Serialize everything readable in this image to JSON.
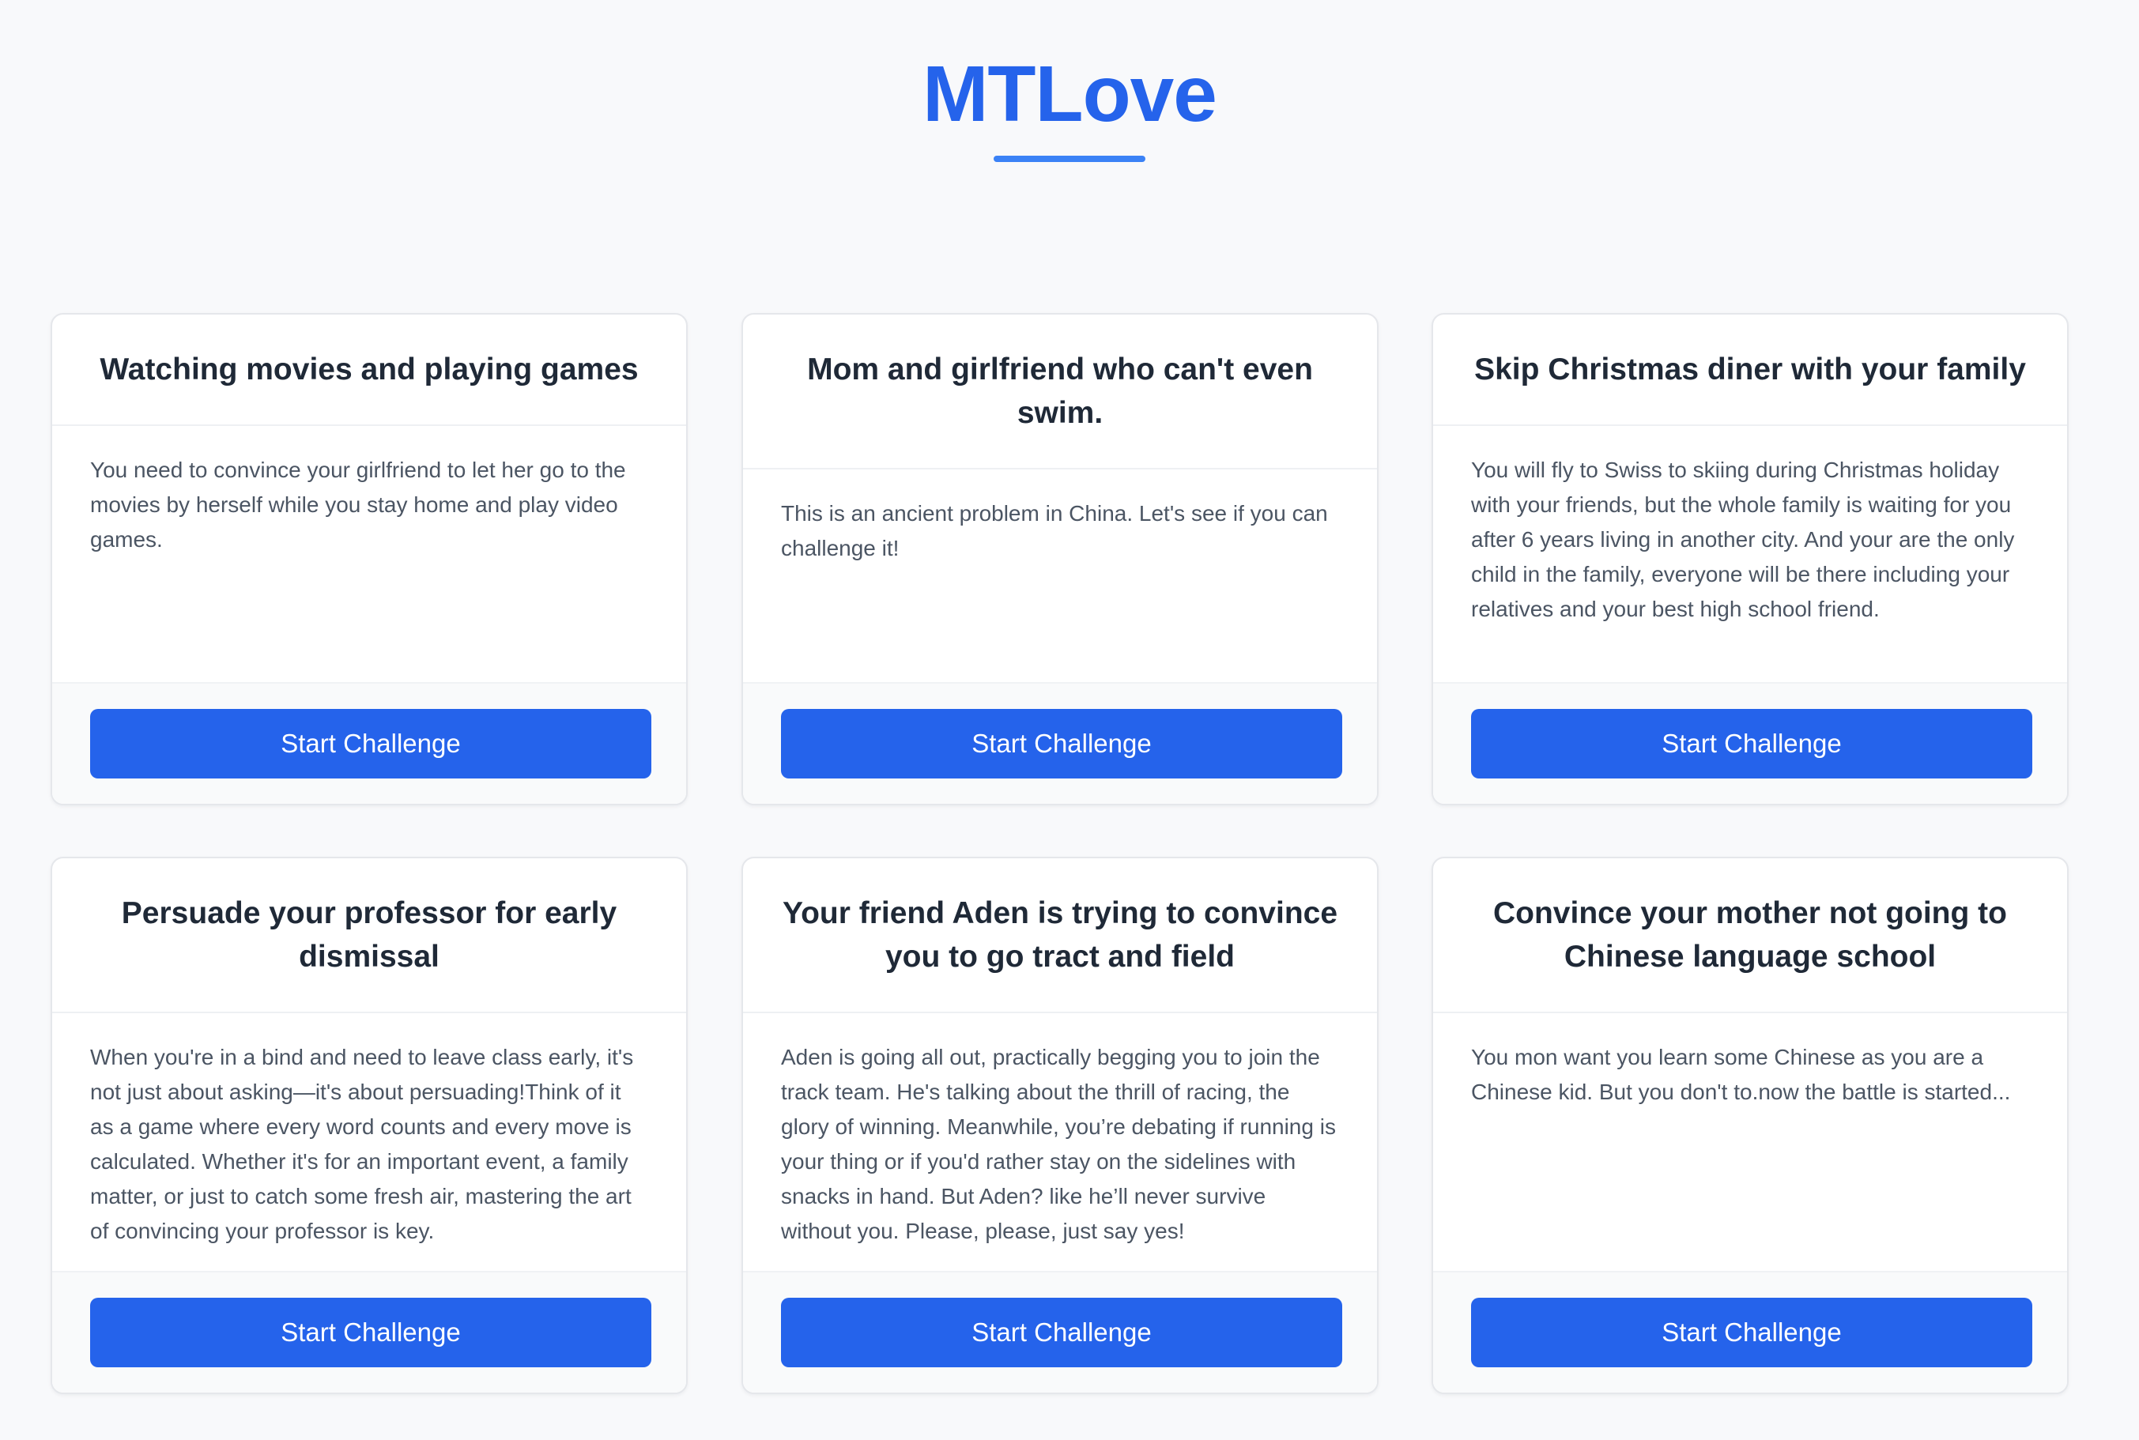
{
  "app": {
    "title": "MTLove",
    "accent_color": "#2563eb"
  },
  "challenges": [
    {
      "title": "Watching movies and playing games",
      "description": "You need to convince your girlfriend to let her go to the movies by herself while you stay home and play video games.",
      "button_label": "Start Challenge"
    },
    {
      "title": "Mom and girlfriend who can't even swim.",
      "description": "This is an ancient problem in China. Let's see if you can challenge it!",
      "button_label": "Start Challenge"
    },
    {
      "title": "Skip Christmas diner with your family",
      "description": "You will fly to Swiss to skiing during Christmas holiday with your friends, but the whole family is waiting for you after 6 years living in another city. And your are the only child in the family, everyone will be there including your relatives and your best high school friend.",
      "button_label": "Start Challenge"
    },
    {
      "title": "Persuade your professor for early dismissal",
      "description": "When you're in a bind and need to leave class early, it's not just about asking—it's about persuading!Think of it as a game where every word counts and every move is calculated. Whether it's for an important event, a family matter, or just to catch some fresh air, mastering the art of convincing your professor is key.",
      "button_label": "Start Challenge"
    },
    {
      "title": "Your friend Aden is trying to convince you to go tract and field",
      "description": "Aden is going all out, practically begging you to join the track team. He's talking about the thrill of racing, the glory of winning. Meanwhile, you’re debating if running is your thing or if you'd rather stay on the sidelines with snacks in hand. But Aden? like he’ll never survive without you. Please, please, just say yes!",
      "button_label": "Start Challenge"
    },
    {
      "title": "Convince your mother not going to Chinese language school",
      "description": "You mon want you learn some Chinese as you are a Chinese kid. But you don't to.now the battle is started...",
      "button_label": "Start Challenge"
    }
  ]
}
